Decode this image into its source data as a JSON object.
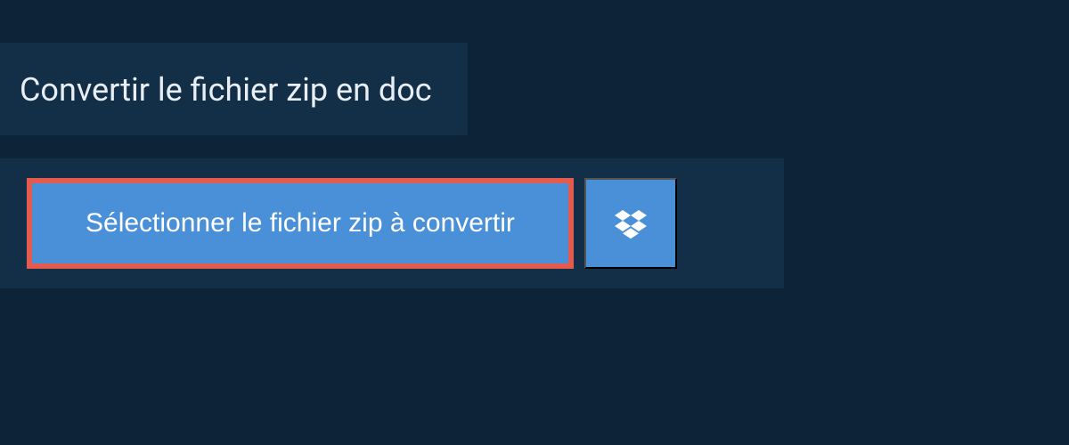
{
  "title": "Convertir le fichier zip en doc",
  "select_button_label": "Sélectionner le fichier zip à convertir",
  "colors": {
    "background": "#0d2438",
    "panel": "#132f47",
    "button": "#4a90d9",
    "highlight_border": "#e35a4f"
  }
}
